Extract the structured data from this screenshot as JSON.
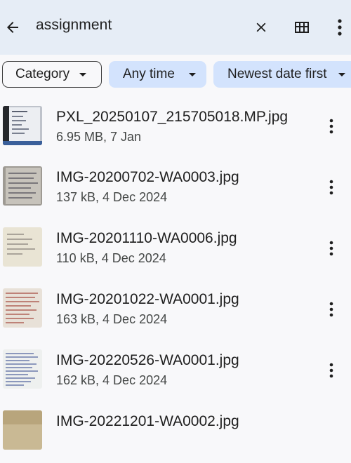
{
  "search": {
    "query": "assignment",
    "icons": [
      "back-arrow-icon",
      "close-icon",
      "grid-view-icon",
      "more-vert-icon"
    ]
  },
  "filters": [
    {
      "label": "Category",
      "style": "outline"
    },
    {
      "label": "Any time",
      "style": "filled"
    },
    {
      "label": "Newest date first",
      "style": "filled"
    }
  ],
  "files": [
    {
      "name": "PXL_20250107_215705018.MP.jpg",
      "meta": "6.95 MB, 7 Jan"
    },
    {
      "name": "IMG-20200702-WA0003.jpg",
      "meta": "137 kB, 4 Dec 2024"
    },
    {
      "name": "IMG-20201110-WA0006.jpg",
      "meta": "110 kB, 4 Dec 2024"
    },
    {
      "name": "IMG-20201022-WA0001.jpg",
      "meta": "163 kB, 4 Dec 2024"
    },
    {
      "name": "IMG-20220526-WA0001.jpg",
      "meta": "162 kB, 4 Dec 2024"
    },
    {
      "name": "IMG-20221201-WA0002.jpg",
      "meta": ""
    }
  ],
  "colors": {
    "topbar_bg": "#e6edf6",
    "chip_filled": "#d3e3fd",
    "page_bg": "#f8f8fa"
  }
}
